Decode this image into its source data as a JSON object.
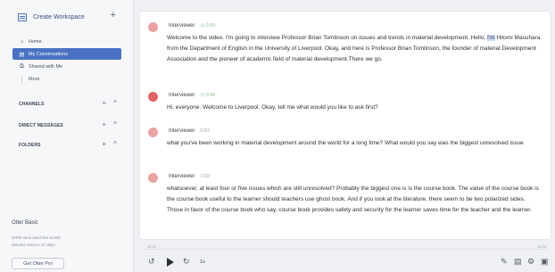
{
  "sidebar": {
    "workspace_label": "Create Workspace",
    "workspace_add": "+",
    "nav": [
      {
        "label": "Home",
        "icon": "home-icon",
        "glyph": "⌂"
      },
      {
        "label": "My Conversations",
        "icon": "conversations-icon",
        "glyph": "▤"
      },
      {
        "label": "Shared with Me",
        "icon": "shared-icon",
        "glyph": "⧉"
      },
      {
        "label": "More",
        "icon": "more-icon",
        "glyph": "⋮"
      }
    ],
    "sections": [
      {
        "label": "CHANNELS",
        "add": "+",
        "toggle": "^"
      },
      {
        "label": "DIRECT MESSAGES",
        "add": "+",
        "toggle": "^"
      },
      {
        "label": "FOLDERS",
        "add": "+",
        "toggle": "^"
      }
    ],
    "plan": {
      "title": "Otter Basic",
      "usage": "0/300 mins used this month",
      "reset": "Minutes reset in 27 days",
      "cta": "Get Otter Pro"
    }
  },
  "transcript": [
    {
      "speaker": "Interviewer",
      "time": "0:00",
      "text_before": "Welcome to the video. I'm going to interview Professor Brian Tomlinson on issues and trends in material development. Hello, ",
      "highlight": "I'm",
      "text_after": " Hitomi Masuhara from the Department of English in the University of Liverpool. Okay, and here is Professor Brian Tomlinson, the founder of material Development Association and the pioneer of academic field of material development.There we go."
    },
    {
      "speaker": "Interviewer",
      "time": "0:46",
      "text": "Hi, everyone. Welcome to Liverpool. Okay, tell me what would you like to ask first?"
    },
    {
      "speaker": "Interviewer",
      "time": "0:52",
      "text": "what you've been working in material development around the world for a long time? What would you say was the biggest unresolved issue"
    },
    {
      "speaker": "Interviewer",
      "time": "1:02",
      "text": "whatsoever, at least four or five issues which are still unresolved? Probably the biggest one is is the course book. The value of the course book is the course book useful to the learner should teachers use ghost book. And if you look at the literature, there seem to be two polarized sides. Those in favor of the course book who say, course book provides safety and security for the learner saves time for the teacher and the learner."
    }
  ],
  "player": {
    "time_current": "00:31",
    "time_total": "10:02",
    "speed": "1x",
    "rewind_glyph": "↺",
    "forward_glyph": "↻"
  },
  "colors": {
    "accent": "#4a72c2",
    "avatar_light": "#e9a3a3",
    "avatar_dark": "#e06363",
    "timestamp_green": "#8cc49b"
  }
}
